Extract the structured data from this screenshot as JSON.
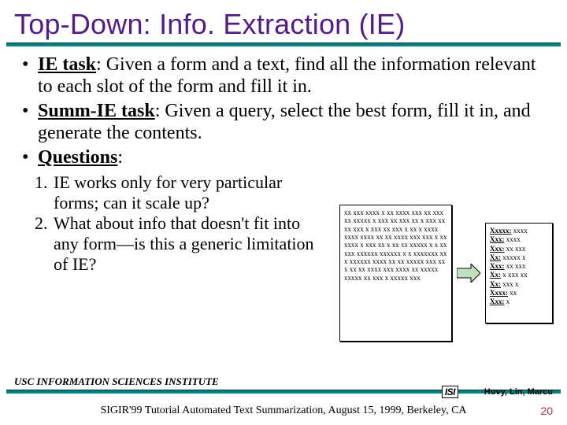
{
  "title": "Top-Down: Info. Extraction (IE)",
  "bullets": [
    {
      "term": "IE task",
      "rest": ":  Given a form and a text, find all the information relevant to each slot of the form and fill it in."
    },
    {
      "term": "Summ-IE task",
      "rest": ":  Given a query, select the best form, fill it in, and generate the contents."
    },
    {
      "term": "Questions",
      "rest": ":"
    }
  ],
  "numbered": [
    "IE works only for very particular forms; can it scale up?",
    "What about info that doesn't fit into any form—is this a generic limitation of IE?"
  ],
  "docboxText": "xx xxx xxxx x xx xxxx xxx xx xxx xx xxxxx x xxx xx xxx xx x xxx xx xx xxx x xxx xx xxx x xx x xxxx xxxx xxxx xx xx xxxx xxx xxx x xx xxxx x xxx xx x xx xx xxxxx x x xx xxx xxxxxx xxxxxx x x xxxxxxx xx x xxxxxx xxxx xx xx xxxxx xxx xx x xx xx xxxx xxx xxxx xx xxxxx xxxxx xx xxx x xxxxx xxx",
  "formRows": [
    {
      "label": "Xxxxx:",
      "val": "xxxx"
    },
    {
      "label": "Xxx:",
      "val": "xxxx"
    },
    {
      "label": "Xxx:",
      "val": "xx xxx"
    },
    {
      "label": "Xx:",
      "val": "xxxxx x"
    },
    {
      "label": "Xxx:",
      "val": "xx xxx"
    },
    {
      "label": "Xx:",
      "val": "x xxx xx"
    },
    {
      "label": "Xx:",
      "val": "xxx x"
    },
    {
      "label": "Xxxx:",
      "val": "xx"
    },
    {
      "label": "Xxx:",
      "val": "x"
    }
  ],
  "footer": {
    "institute": "USC INFORMATION SCIENCES INSTITUTE",
    "isi": "ISI",
    "authors": "Hovy, Lin, Marcu",
    "caption": "SIGIR'99 Tutorial Automated Text Summarization, August 15, 1999, Berkeley, CA",
    "page": "20"
  }
}
